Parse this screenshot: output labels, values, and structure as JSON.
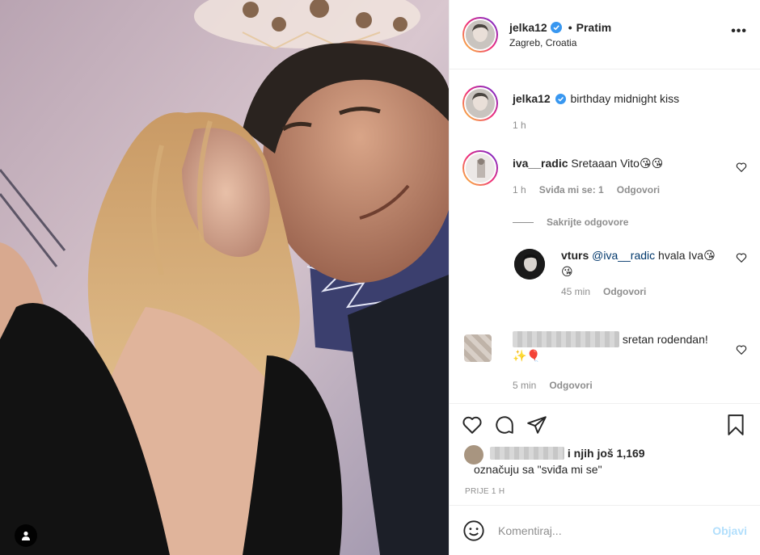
{
  "post": {
    "username": "jelka12",
    "follow_label": "Pratim",
    "location": "Zagreb, Croatia",
    "more_icon": "more-options-icon",
    "caption": "birthday midnight kiss",
    "caption_time": "1 h"
  },
  "comments": [
    {
      "username": "iva__radic",
      "text": "Sretaaan Vito😘😘",
      "time": "1 h",
      "likes_label": "Sviđa mi se: 1",
      "reply_label": "Odgovori"
    }
  ],
  "hide_replies_label": "Sakrijte odgovore",
  "reply": {
    "username": "vturs",
    "mention": "@iva__radic",
    "text": "hvala Iva😘😘",
    "time": "45 min",
    "reply_label": "Odgovori"
  },
  "comment2": {
    "username_blurred": "anonymous",
    "text": "sretan rodendan! ✨🎈",
    "time": "5 min",
    "reply_label": "Odgovori"
  },
  "likes": {
    "line1": "i njih još 1,169",
    "line2": "označuju sa \"sviđa mi se\""
  },
  "timestamp": "PRIJE 1 H",
  "composer": {
    "placeholder": "Komentiraj...",
    "post_label": "Objavi"
  },
  "colors": {
    "link": "#00376b",
    "verified": "#3897f0",
    "muted": "#8e8e8e",
    "post_disabled": "#b2dffc"
  }
}
